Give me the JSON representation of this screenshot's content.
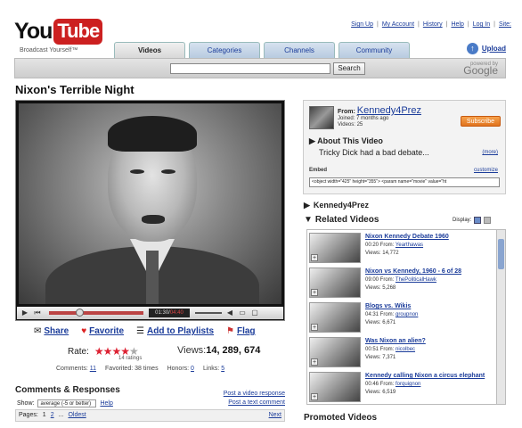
{
  "header": {
    "logo_you": "You",
    "logo_tube": "Tube",
    "tagline": "Broadcast Yourself™",
    "toplinks": [
      "Sign Up",
      "My Account",
      "History",
      "Help",
      "Log In",
      "Site:"
    ],
    "upload": "Upload",
    "tabs": [
      "Videos",
      "Categories",
      "Channels",
      "Community"
    ],
    "search_button": "Search",
    "powered_by": "powered by",
    "google": "Google"
  },
  "video": {
    "title": "Nixon's Terrible Night",
    "time_current": "01:30",
    "time_total": "04:40",
    "progress_fraction": 0.32
  },
  "actions": {
    "share": "Share",
    "favorite": "Favorite",
    "add_playlists": "Add to Playlists",
    "flag": "Flag"
  },
  "rating": {
    "label": "Rate:",
    "stars": 4,
    "max_stars": 5,
    "ratings_text": "14 ratings",
    "views_label": "Views:",
    "views_value": "14, 289, 674"
  },
  "stats": {
    "comments_label": "Comments:",
    "comments_value": "11",
    "favorited_label": "Favorited:",
    "favorited_value": "38 times",
    "honors_label": "Honors:",
    "honors_value": "0",
    "links_label": "Links:",
    "links_value": "5"
  },
  "comments": {
    "heading": "Comments & Responses",
    "post_video": "Post a video response",
    "post_text": "Post a text comment",
    "show_label": "Show:",
    "show_value": "average (-5 or better)",
    "help": "Help",
    "pages_label": "Pages:",
    "page1": "1",
    "page2": "2",
    "ellipsis": "...",
    "oldest": "Oldest",
    "next": "Next"
  },
  "channel": {
    "from_label": "From:",
    "username": "Kennedy4Prez",
    "joined": "Joined: 7 months ago",
    "videos": "Videos: 25",
    "subscribe": "Subscribe",
    "about_heading": "About This Video",
    "about_text": "Tricky Dick had a bad debate...",
    "more": "(more)",
    "embed_label": "Embed",
    "customize": "customize",
    "embed_code": "<object width=\"425\" height=\"355\"> <param name=\"movie\" value=\"ht"
  },
  "sidebar": {
    "section_user": "Kennedy4Prez",
    "section_related": "Related Videos",
    "display_label": "Display:",
    "promoted": "Promoted Videos"
  },
  "related": [
    {
      "title": "Nixon Kennedy Debate 1960",
      "duration": "00:20",
      "from": "Yearthawas",
      "views": "Views: 14,772"
    },
    {
      "title": "Nixon vs Kennedy, 1960 - 6 of 28",
      "duration": "09:00",
      "from": "ThePoliticalHawk",
      "views": "Views: 5,268"
    },
    {
      "title": "Blogs vs. Wikis",
      "duration": "04:31",
      "from": "groupnon",
      "views": "Views: 6,671"
    },
    {
      "title": "Was Nixon an alien?",
      "duration": "00:51",
      "from": "nicolbec",
      "views": "Views: 7,371"
    },
    {
      "title": "Kennedy calling Nixon a circus elephant",
      "duration": "00:46",
      "from": "forquignon",
      "views": "Views: 6,519"
    }
  ],
  "colors": {
    "link": "#1b3c9a",
    "logo_red": "#cc2020",
    "subscribe_orange": "#e0731e",
    "progress_red": "#bb4444"
  }
}
